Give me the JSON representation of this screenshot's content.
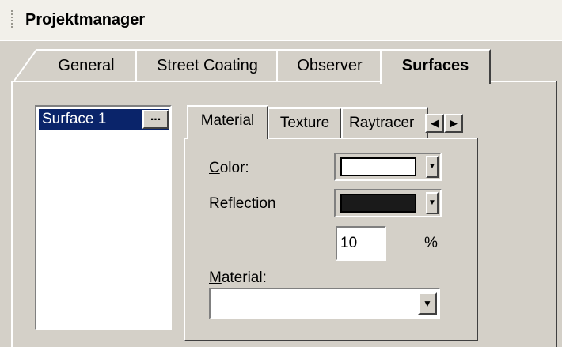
{
  "title": "Projektmanager",
  "tabs": [
    "General",
    "Street Coating",
    "Observer",
    "Surfaces"
  ],
  "surfaces": {
    "items": [
      "Surface 1"
    ],
    "item_button": "..."
  },
  "inner_tabs": [
    "Material",
    "Texture",
    "Raytracer"
  ],
  "icons": {
    "scroll_left": "◀",
    "scroll_right": "▶",
    "dropdown": "▼"
  },
  "material": {
    "color_label_accel": "C",
    "color_label_rest": "olor:",
    "color_value": "#ffffff",
    "reflection_label": "Reflection",
    "reflection_value": "#1a1a1a",
    "percent_value": "10",
    "percent_unit": "%",
    "material_label_accel": "M",
    "material_label_rest": "aterial:",
    "material_value": ""
  }
}
